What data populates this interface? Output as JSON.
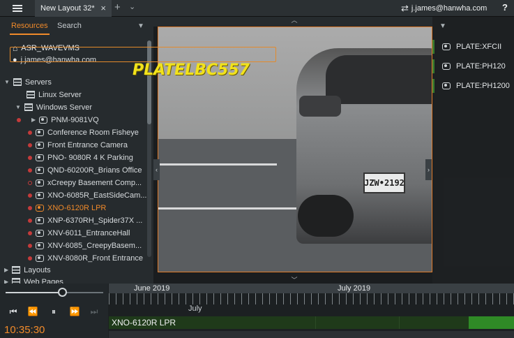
{
  "topbar": {
    "tab_title": "New Layout 32*",
    "tab_close": "×",
    "add_tab": "+",
    "tab_menu": "⌄",
    "user": "j.james@hanwha.com",
    "help": "?"
  },
  "resources": {
    "tab_resources": "Resources",
    "tab_search": "Search",
    "system_name": "ASR_WAVEVMS",
    "user": "j.james@hanwha.com",
    "servers_label": "Servers",
    "linux_server": "Linux Server",
    "windows_server": "Windows Server",
    "nvr": "PNM-9081VQ",
    "cameras": [
      {
        "name": "Conference Room Fisheye"
      },
      {
        "name": "Front Entrance Camera"
      },
      {
        "name": "PNO- 9080R 4 K Parking"
      },
      {
        "name": "QND-60200R_Brians Office"
      },
      {
        "name": "xCreepy Basement Comp..."
      },
      {
        "name": "XNO-6085R_EastSideCam..."
      },
      {
        "name": "XNO-6120R LPR"
      },
      {
        "name": "XNP-6370RH_Spider37X ..."
      },
      {
        "name": "XNV-6011_EntranceHall"
      },
      {
        "name": "XNV-6085_CreepyBasem..."
      },
      {
        "name": "XNV-8080R_Front Entrance"
      }
    ],
    "layouts_label": "Layouts",
    "webpages_label": "Web Pages"
  },
  "viewer": {
    "overlay_text": "PLATELBC557",
    "plate_text": "JZW•2192"
  },
  "notifications": [
    {
      "label": "PLATE:XFCII"
    },
    {
      "label": "PLATE:PH120"
    },
    {
      "label": "PLATE:PH1200"
    }
  ],
  "timeline": {
    "month_1": "June 2019",
    "month_2": "July 2019",
    "sub_label": "July",
    "clock": "10:35:30",
    "track_label": "XNO-6120R LPR",
    "volume_fraction": 0.58
  }
}
